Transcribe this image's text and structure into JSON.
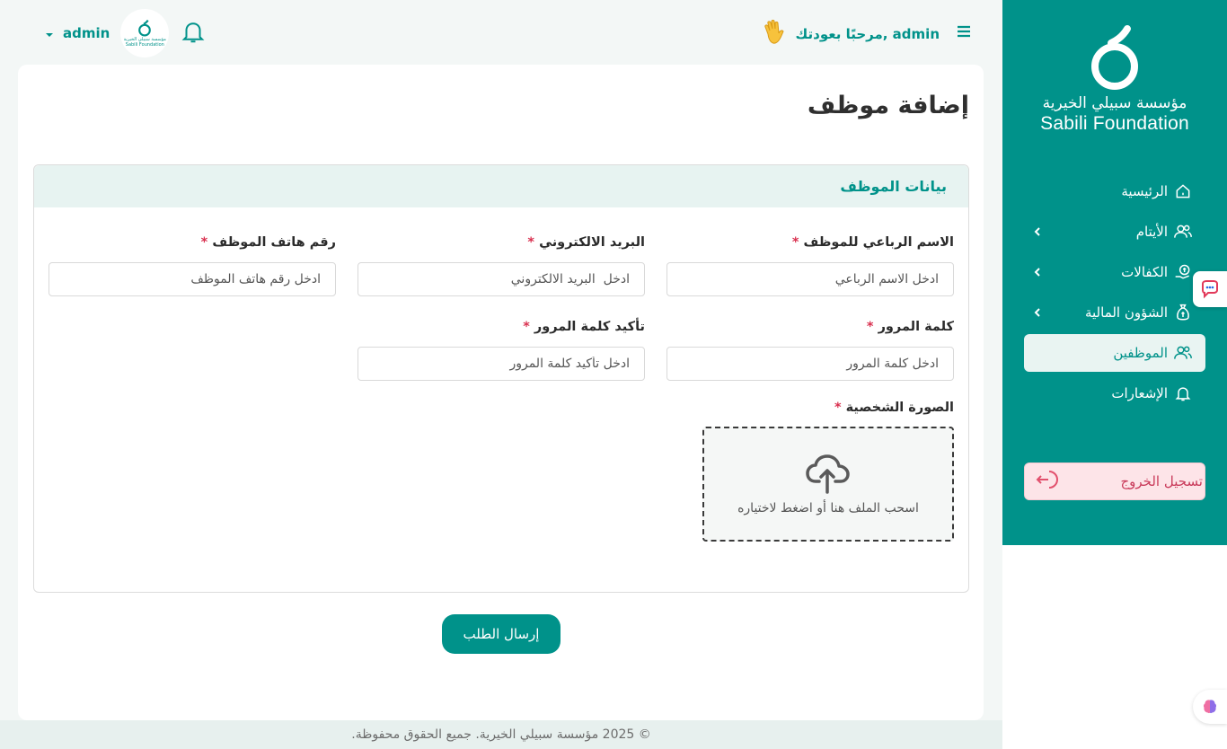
{
  "brand": {
    "name_ar": "مؤسسة سبيلي الخيرية",
    "name_en": "Sabili Foundation",
    "colors": {
      "primary": "#00928a",
      "danger": "#d9304f",
      "active_bg": "#e9f4f2"
    }
  },
  "sidebar": {
    "items": [
      {
        "label": "الرئيسية",
        "icon": "home-icon",
        "has_submenu": false,
        "active": false
      },
      {
        "label": "الأيتام",
        "icon": "users-icon",
        "has_submenu": true,
        "active": false
      },
      {
        "label": "الكفالات",
        "icon": "hand-coin-icon",
        "has_submenu": true,
        "active": false
      },
      {
        "label": "الشؤون المالية",
        "icon": "money-bag-icon",
        "has_submenu": true,
        "active": false
      },
      {
        "label": "الموظفين",
        "icon": "users-icon",
        "has_submenu": false,
        "active": true
      },
      {
        "label": "الإشعارات",
        "icon": "bell-icon",
        "has_submenu": false,
        "active": false
      }
    ],
    "logout_label": "تسجيل الخروج"
  },
  "header": {
    "welcome": "مرحبًا بعودتك, admin",
    "user_name": "admin"
  },
  "page": {
    "title": "إضافة موظف",
    "section_title": "بيانات الموظف",
    "fields": {
      "full_name": {
        "label": "الاسم الرباعي للموظف",
        "placeholder": "ادخل الاسم الرباعي",
        "value": ""
      },
      "email": {
        "label": "البريد الالكتروني",
        "placeholder": "ادخل  البريد الالكتروني",
        "value": ""
      },
      "phone": {
        "label": "رقم هاتف الموظف",
        "placeholder": "ادخل رقم هاتف الموظف",
        "value": ""
      },
      "password": {
        "label": "كلمة المرور",
        "placeholder": "ادخل كلمة المرور",
        "value": ""
      },
      "confirm_password": {
        "label": "تأكيد كلمة المرور",
        "placeholder": "ادخل تأكيد كلمة المرور",
        "value": ""
      }
    },
    "required_mark": "*",
    "upload": {
      "label": "الصورة الشخصية",
      "hint": "اسحب الملف هنا أو اضغط لاختياره"
    },
    "submit_label": "إرسال الطلب"
  },
  "footer": {
    "text": "© 2025 مؤسسة سبيلي الخيرية. جميع الحقوق محفوظة."
  }
}
